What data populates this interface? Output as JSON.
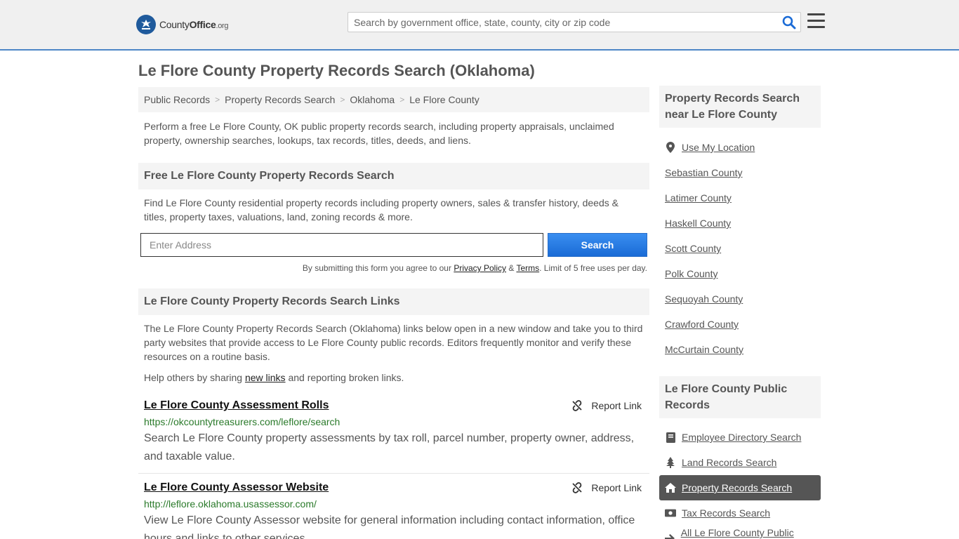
{
  "header": {
    "logo_county": "County",
    "logo_office": "Office",
    "logo_org": ".org",
    "search_placeholder": "Search by government office, state, county, city or zip code"
  },
  "page": {
    "title": "Le Flore County Property Records Search (Oklahoma)",
    "breadcrumb": [
      "Public Records",
      "Property Records Search",
      "Oklahoma",
      "Le Flore County"
    ],
    "intro": "Perform a free Le Flore County, OK public property records search, including property appraisals, unclaimed property, ownership searches, lookups, tax records, titles, deeds, and liens."
  },
  "free_search": {
    "heading": "Free Le Flore County Property Records Search",
    "description": "Find Le Flore County residential property records including property owners, sales & transfer history, deeds & titles, property taxes, valuations, land, zoning records & more.",
    "address_placeholder": "Enter Address",
    "button_label": "Search",
    "disclaimer_prefix": "By submitting this form you agree to our ",
    "privacy_label": "Privacy Policy",
    "amp": " & ",
    "terms_label": "Terms",
    "disclaimer_suffix": ". Limit of 5 free uses per day."
  },
  "links_section": {
    "heading": "Le Flore County Property Records Search Links",
    "description": "The Le Flore County Property Records Search (Oklahoma) links below open in a new window and take you to third party websites that provide access to Le Flore County public records. Editors frequently monitor and verify these resources on a routine basis.",
    "help_prefix": "Help others by sharing ",
    "help_link": "new links",
    "help_suffix": " and reporting broken links.",
    "report_label": "Report Link",
    "items": [
      {
        "title": "Le Flore County Assessment Rolls",
        "url": "https://okcountytreasurers.com/leflore/search",
        "description": "Search Le Flore County property assessments by tax roll, parcel number, property owner, address, and taxable value."
      },
      {
        "title": "Le Flore County Assessor Website",
        "url": "http://leflore.oklahoma.usassessor.com/",
        "description": "View Le Flore County Assessor website for general information including contact information, office hours and links to other services."
      }
    ]
  },
  "sidebar": {
    "nearby_heading": "Property Records Search near Le Flore County",
    "use_location": "Use My Location",
    "nearby": [
      "Sebastian County",
      "Latimer County",
      "Haskell County",
      "Scott County",
      "Polk County",
      "Sequoyah County",
      "Crawford County",
      "McCurtain County"
    ],
    "public_heading": "Le Flore County Public Records",
    "public_items": [
      {
        "label": "Employee Directory Search",
        "icon": "book-icon"
      },
      {
        "label": "Land Records Search",
        "icon": "tree-icon"
      },
      {
        "label": "Property Records Search",
        "icon": "home-icon"
      },
      {
        "label": "Tax Records Search",
        "icon": "money-icon"
      },
      {
        "label": "All Le Flore County Public Records",
        "icon": "arrow-right-icon"
      }
    ]
  },
  "colors": {
    "accent_blue": "#1a6bd6",
    "header_bg": "#f0f0f0",
    "url_green": "#2a7a2a",
    "active_bg": "#555555"
  }
}
